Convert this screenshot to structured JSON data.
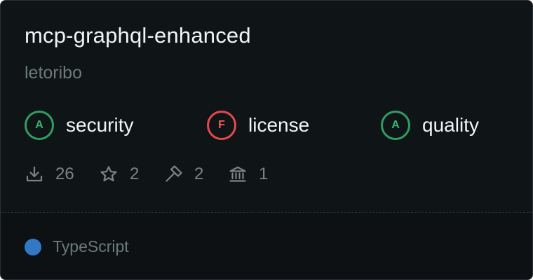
{
  "repo": {
    "name": "mcp-graphql-enhanced",
    "owner": "letoribo"
  },
  "grades": [
    {
      "letter": "A",
      "label": "security",
      "status": "pass"
    },
    {
      "letter": "F",
      "label": "license",
      "status": "fail"
    },
    {
      "letter": "A",
      "label": "quality",
      "status": "pass"
    }
  ],
  "stats": {
    "downloads": "26",
    "stars": "2",
    "tools": "2",
    "institutions": "1"
  },
  "icons": {
    "downloads": "download-icon",
    "stars": "star-icon",
    "tools": "hammer-icon",
    "institutions": "bank-icon"
  },
  "language": {
    "name": "TypeScript",
    "color": "#3178c6"
  },
  "colors": {
    "pass": "#2e9e62",
    "fail": "#e5484d",
    "background": "#0f1416"
  }
}
